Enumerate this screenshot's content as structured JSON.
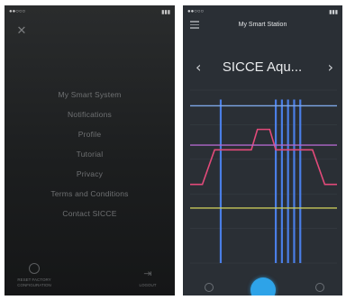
{
  "left_screen": {
    "menu": [
      "My Smart System",
      "Notifications",
      "Profile",
      "Tutorial",
      "Privacy",
      "Terms and Conditions",
      "Contact SICCE"
    ],
    "bottom_left_label": "RESET FACTORY CONFIGURATION",
    "bottom_right_label": "LOGOUT"
  },
  "right_screen": {
    "nav_title": "My Smart Station",
    "device_name": "SICCE Aqu...",
    "accent_color": "#2ea3e8"
  },
  "chart_data": {
    "type": "line",
    "x": [
      0,
      2,
      4,
      5,
      6,
      8,
      10,
      11,
      12,
      13,
      14,
      16,
      18,
      20,
      22,
      24
    ],
    "series": [
      {
        "values": [
          50,
          50,
          72,
          72,
          72,
          72,
          72,
          85,
          85,
          85,
          72,
          72,
          72,
          72,
          50,
          50
        ],
        "color": "#e24a7a"
      },
      {
        "values": [
          100,
          100,
          100,
          100,
          100,
          100,
          100,
          100,
          100,
          100,
          100,
          100,
          100,
          100,
          100,
          100
        ],
        "color": "#7fa8e8"
      },
      {
        "values": [
          75,
          75,
          75,
          75,
          75,
          75,
          75,
          75,
          75,
          75,
          75,
          75,
          75,
          75,
          75,
          75
        ],
        "color": "#b067c9"
      },
      {
        "values": [
          35,
          35,
          35,
          35,
          35,
          35,
          35,
          35,
          35,
          35,
          35,
          35,
          35,
          35,
          35,
          35
        ],
        "color": "#c7c85a"
      }
    ],
    "vertical_events_x": [
      5,
      14,
      15,
      16,
      17,
      18
    ],
    "event_color": "#4a7ee6",
    "ylim": [
      0,
      110
    ],
    "xlim": [
      0,
      24
    ]
  }
}
